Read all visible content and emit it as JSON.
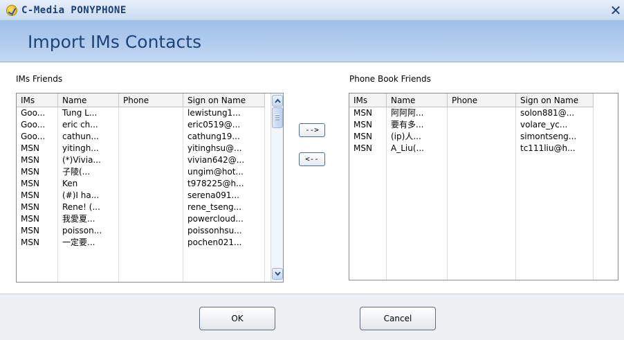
{
  "window": {
    "title": "C-Media PONYPHONE",
    "close_glyph": "✕"
  },
  "header": {
    "title": "Import IMs Contacts"
  },
  "left_panel": {
    "label": "IMs Friends",
    "columns": [
      "IMs",
      "Name",
      "Phone",
      "Sign on Name"
    ],
    "rows": [
      [
        "Goo...",
        "Tung L...",
        "",
        "lewistung1..."
      ],
      [
        "Goo...",
        "eric ch...",
        "",
        "eric0519@..."
      ],
      [
        "Goo...",
        "cathun...",
        "",
        "cathung19..."
      ],
      [
        "MSN",
        "yitingh...",
        "",
        "yitinghsu@..."
      ],
      [
        "MSN",
        "(*)Vivia...",
        "",
        "vivian642@..."
      ],
      [
        "MSN",
        "子陵(...",
        "",
        "ungim@hot..."
      ],
      [
        "MSN",
        "Ken",
        "",
        "t978225@h..."
      ],
      [
        "MSN",
        "(#)I ha...",
        "",
        "serena091..."
      ],
      [
        "MSN",
        "Rene! (...",
        "",
        "rene_tseng..."
      ],
      [
        "MSN",
        "我愛夏...",
        "",
        "powercloud..."
      ],
      [
        "MSN",
        "poisson...",
        "",
        "poissonhsu..."
      ],
      [
        "MSN",
        "一定要...",
        "",
        "pochen021..."
      ]
    ]
  },
  "right_panel": {
    "label": "Phone Book Friends",
    "columns": [
      "IMs",
      "Name",
      "Phone",
      "Sign on Name"
    ],
    "rows": [
      [
        "MSN",
        "阿阿阿...",
        "",
        "solon881@..."
      ],
      [
        "MSN",
        "要有多...",
        "",
        "volare_yc..."
      ],
      [
        "MSN",
        "(ip)人...",
        "",
        "simontseng..."
      ],
      [
        "MSN",
        "A_Liu(...",
        "",
        "tc111liu@h..."
      ]
    ]
  },
  "transfer": {
    "add_label": "-->",
    "remove_label": "<--"
  },
  "footer": {
    "ok_label": "OK",
    "cancel_label": "Cancel"
  }
}
